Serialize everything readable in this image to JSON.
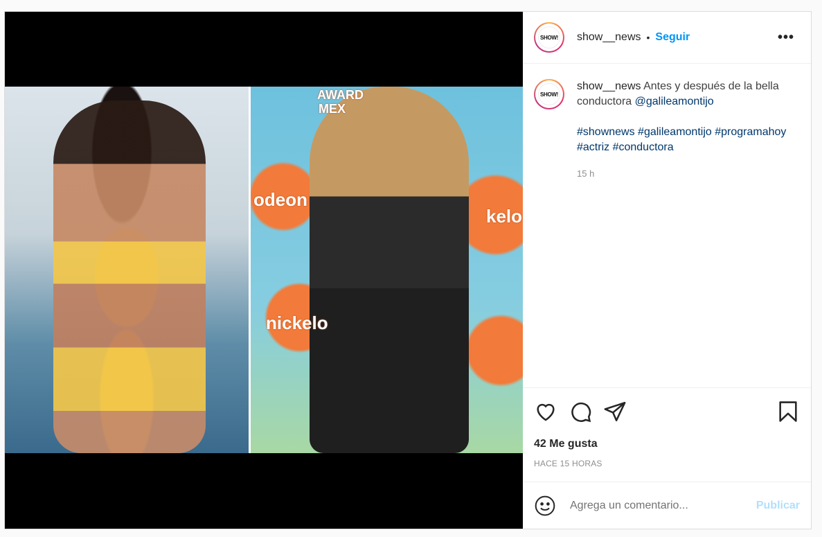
{
  "post": {
    "username": "show__news",
    "follow_label": "Seguir",
    "separator": "•",
    "more_label": "•••",
    "avatar_logo": "SHOW!",
    "caption": {
      "text": "Antes y después de la bella conductora",
      "mention": "@galileamontijo",
      "hashtags": "#shownews #galileamontijo #programahoy #actriz #conductora",
      "time_ago": "15 h"
    },
    "likes": "42 Me gusta",
    "timestamp": "HACE 15 HORAS",
    "comment_placeholder": "Agrega un comentario...",
    "publish_label": "Publicar",
    "photo_brand_1": "odeon",
    "photo_brand_2": "nickelo",
    "photo_brand_3": "kelo",
    "photo_brand_4": "AWARD",
    "photo_brand_5": "MEX"
  },
  "colors": {
    "follow": "#0095f6",
    "publish_disabled": "#b2dffc",
    "mention": "#00376b"
  },
  "icons": [
    "heart-icon",
    "comment-icon",
    "share-icon",
    "bookmark-icon",
    "emoji-icon",
    "more-icon"
  ]
}
